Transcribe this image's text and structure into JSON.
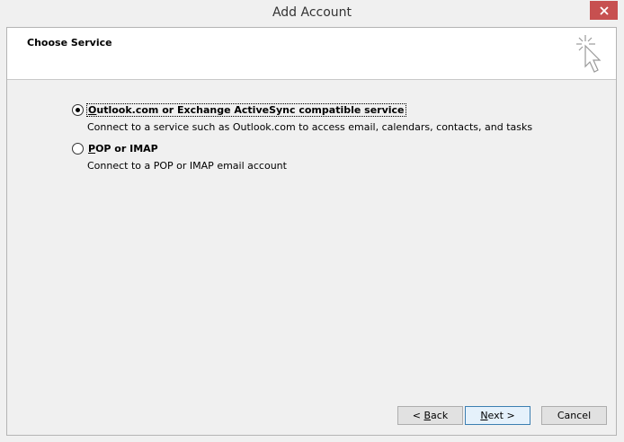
{
  "window": {
    "title": "Add Account"
  },
  "header": {
    "title": "Choose Service",
    "icon": "wizard-cursor-icon"
  },
  "options": [
    {
      "label_prefix": "",
      "label_mnemonic": "O",
      "label_rest": "utlook.com or Exchange ActiveSync compatible service",
      "description": "Connect to a service such as Outlook.com to access email, calendars, contacts, and tasks",
      "selected": true
    },
    {
      "label_prefix": "",
      "label_mnemonic": "P",
      "label_rest": "OP or IMAP",
      "description": "Connect to a POP or IMAP email account",
      "selected": false
    }
  ],
  "buttons": {
    "back_prefix": "< ",
    "back_mnemonic": "B",
    "back_rest": "ack",
    "next_mnemonic": "N",
    "next_rest": "ext >",
    "cancel": "Cancel"
  },
  "colors": {
    "close_button": "#c75050",
    "default_button_border": "#3c7fb1",
    "background": "#f0f0f0"
  }
}
